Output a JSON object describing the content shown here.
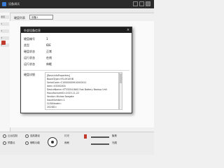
{
  "window": {
    "title": "设备调试"
  },
  "toolbar": {
    "device_label": "硬盘列表",
    "device_select": "设备1"
  },
  "left_panel": {
    "items": [
      "通道",
      "1",
      "2",
      "3",
      "4",
      "5"
    ]
  },
  "dialog": {
    "title": "外部设备信息",
    "close": "×",
    "rows": [
      {
        "label": "硬盘编号",
        "value": "1"
      },
      {
        "label": "类型",
        "value": "IDE"
      },
      {
        "label": "硬盘状态",
        "value": "正常"
      },
      {
        "label": "运行状态",
        "value": "在线"
      },
      {
        "label": "运行状态",
        "value": "休眠"
      }
    ],
    "info_label": "硬盘详细",
    "info_lines": [
      "[BasicInfoProperties]",
      "BoardType=97L0910HB",
      "SerialCode=C10000009910000011",
      "Item=0320G000",
      "DeviceName=ST3320418AS Fast Battery Backup Unit",
      "ManufacturerID=2023-11-22",
      "Vendor=Hiview Seagate",
      "IssueNumber=1",
      "CLEANcode=",
      "2024ID="
    ]
  },
  "bottom": {
    "items": [
      "云台控制",
      "预置点",
      "巡航路径",
      "辅助功能",
      "灯光",
      "雨刷",
      "聚焦",
      "光圈"
    ]
  },
  "colors": {
    "accent": "#c0392b",
    "titlebar": "#2b2b2b"
  }
}
